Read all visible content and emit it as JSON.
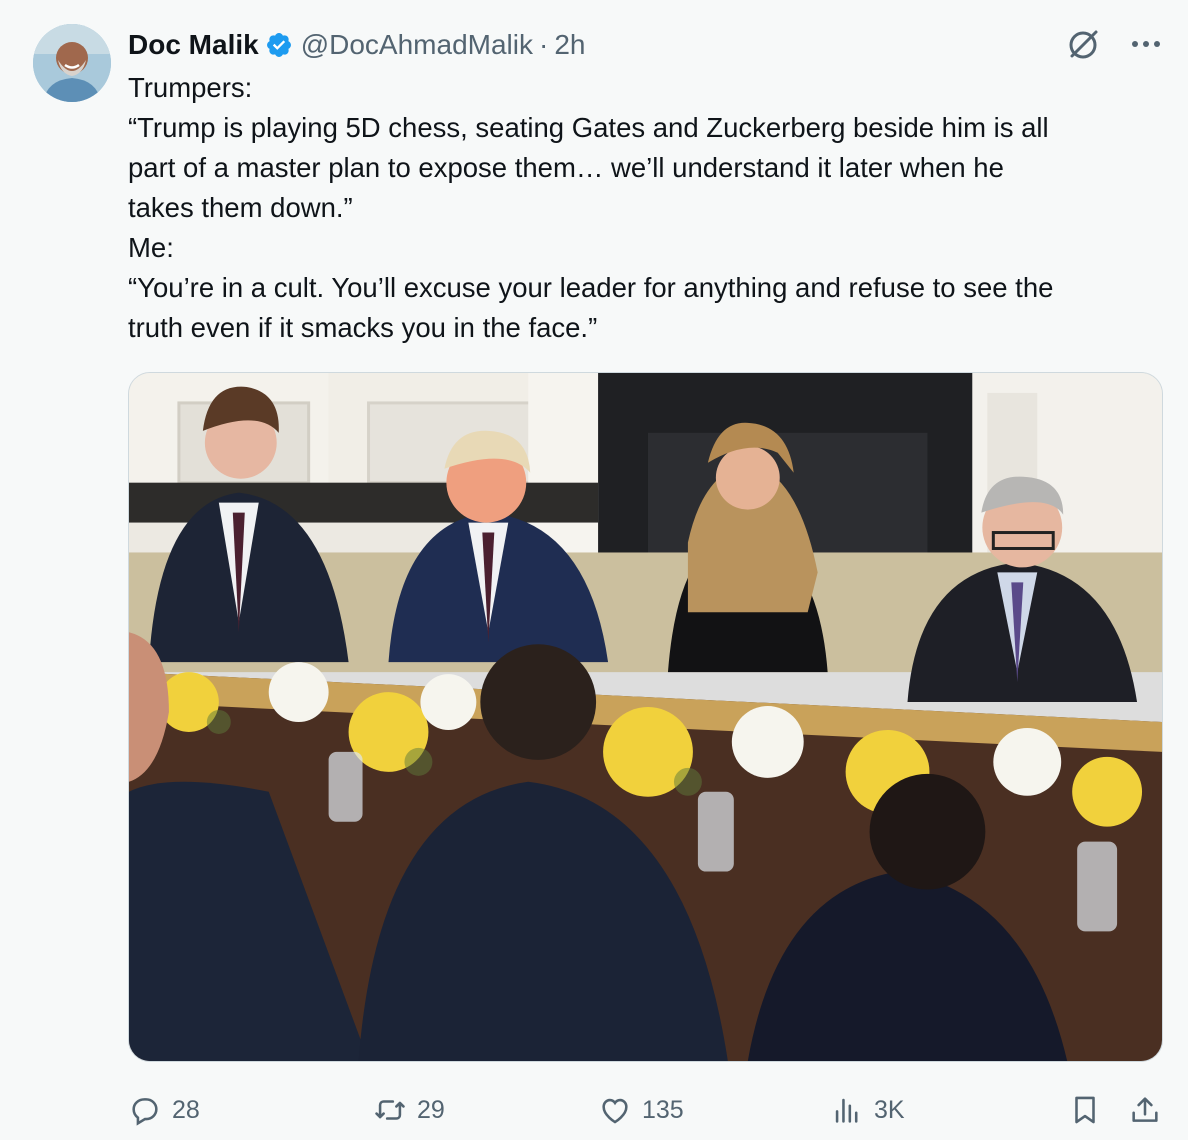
{
  "author": {
    "display_name": "Doc Malik",
    "handle": "@DocAhmadMalik",
    "separator": "·",
    "time": "2h",
    "verified": true
  },
  "tweet": {
    "lines": [
      "Trumpers:",
      "“Trump is playing 5D chess, seating Gates and Zuckerberg beside him is all",
      "part of a master plan to expose them… we’ll understand it later when he",
      "takes them down.”",
      "Me:",
      "“You’re in a cult. You’ll excuse your leader for anything and refuse to see the",
      "truth even if it smacks you in the face.”"
    ]
  },
  "icons": {
    "avatar": "avatar",
    "verified": "verified-badge-icon",
    "grok": "grok-icon",
    "more": "more-icon",
    "reply": "reply-icon",
    "repost": "repost-icon",
    "like": "like-icon",
    "views": "views-icon",
    "bookmark": "bookmark-icon",
    "share": "share-icon"
  },
  "actions": {
    "replies": "28",
    "reposts": "29",
    "likes": "135",
    "views": "3K"
  },
  "colors": {
    "verified": "#1d9bf0",
    "secondary_text": "#536471",
    "primary_text": "#0f1419",
    "background": "#f7f9f9"
  }
}
